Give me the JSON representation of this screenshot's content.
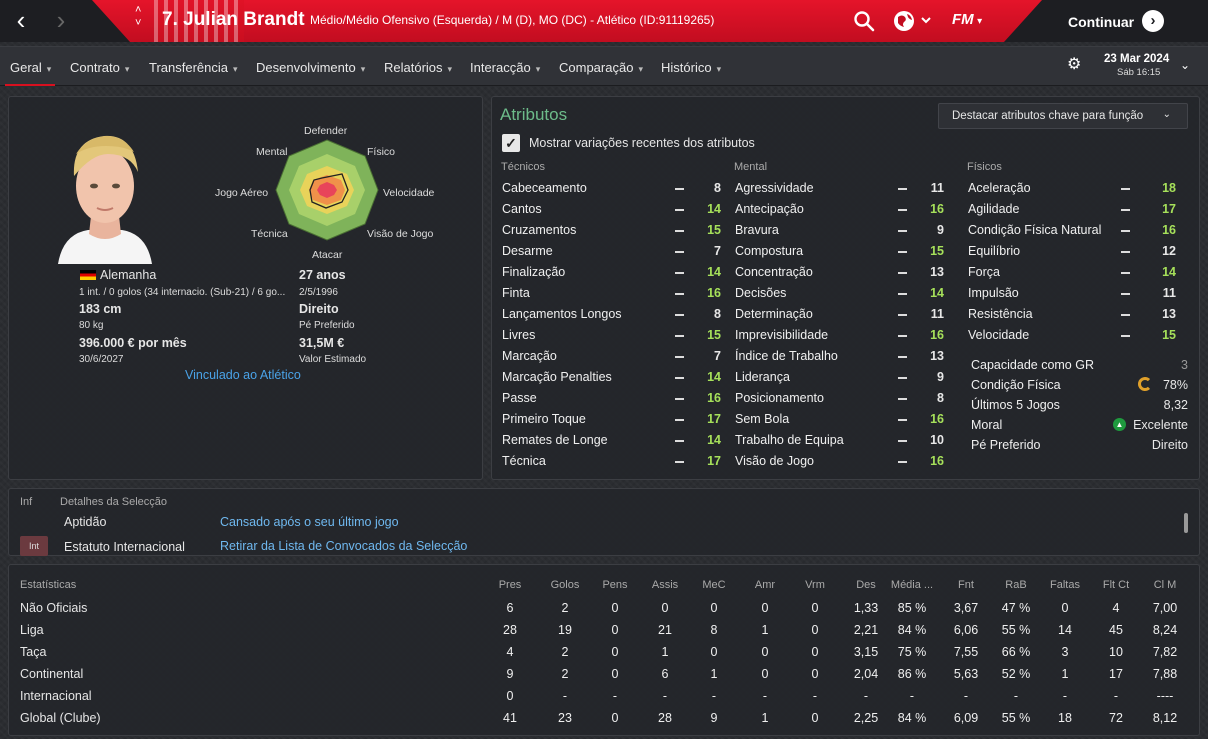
{
  "header": {
    "back_icon": "chevron-left-icon",
    "forward_icon": "chevron-right-icon",
    "title": "7. Julian Brandt",
    "subtitle": "Médio/Médio Ofensivo (Esquerda) / M (D), MO (DC) - Atlético (ID:91119265)",
    "continue_label": "Continuar",
    "logo_text": "FM",
    "accent_color": "#d8101f"
  },
  "tabs": [
    {
      "label": "Geral"
    },
    {
      "label": "Contrato"
    },
    {
      "label": "Transferência"
    },
    {
      "label": "Desenvolvimento"
    },
    {
      "label": "Relatórios"
    },
    {
      "label": "Interacção"
    },
    {
      "label": "Comparação"
    },
    {
      "label": "Histórico"
    }
  ],
  "clock": {
    "date": "23 Mar 2024",
    "time": "Sáb 16:15"
  },
  "profile": {
    "radar_labels": {
      "top": "Defender",
      "top_left": "Mental",
      "top_right": "Físico",
      "left": "Jogo Aéreo",
      "right": "Velocidade",
      "bottom_left": "Técnica",
      "bottom_right": "Visão de Jogo",
      "bottom": "Atacar"
    },
    "nationality": "Alemanha",
    "caps": "1 int. / 0 golos (34 internacio. (Sub-21) / 6 go...",
    "height": "183 cm",
    "weight": "80 kg",
    "wage": "396.000 € por mês",
    "contract_end": "30/6/2027",
    "age": "27 anos",
    "dob": "2/5/1996",
    "preferred_foot": "Direito",
    "preferred_foot_label": "Pé Preferido",
    "value": "31,5M €",
    "value_label": "Valor Estimado",
    "club_link": "Vinculado ao Atlético"
  },
  "attributes": {
    "title": "Atributos",
    "highlight_dropdown": "Destacar atributos chave para função",
    "show_changes_label": "Mostrar variações recentes dos atributos",
    "show_changes_checked": true,
    "technical_header": "Técnicos",
    "mental_header": "Mental",
    "physical_header": "Físicos",
    "technical": [
      {
        "name": "Cabeceamento",
        "value": "8"
      },
      {
        "name": "Cantos",
        "value": "14"
      },
      {
        "name": "Cruzamentos",
        "value": "15"
      },
      {
        "name": "Desarme",
        "value": "7"
      },
      {
        "name": "Finalização",
        "value": "14"
      },
      {
        "name": "Finta",
        "value": "16"
      },
      {
        "name": "Lançamentos Longos",
        "value": "8"
      },
      {
        "name": "Livres",
        "value": "15"
      },
      {
        "name": "Marcação",
        "value": "7"
      },
      {
        "name": "Marcação Penalties",
        "value": "14"
      },
      {
        "name": "Passe",
        "value": "16"
      },
      {
        "name": "Primeiro Toque",
        "value": "17"
      },
      {
        "name": "Remates de Longe",
        "value": "14"
      },
      {
        "name": "Técnica",
        "value": "17"
      }
    ],
    "mental": [
      {
        "name": "Agressividade",
        "value": "11"
      },
      {
        "name": "Antecipação",
        "value": "16"
      },
      {
        "name": "Bravura",
        "value": "9"
      },
      {
        "name": "Compostura",
        "value": "15"
      },
      {
        "name": "Concentração",
        "value": "13"
      },
      {
        "name": "Decisões",
        "value": "14"
      },
      {
        "name": "Determinação",
        "value": "11"
      },
      {
        "name": "Imprevisibilidade",
        "value": "16"
      },
      {
        "name": "Índice de Trabalho",
        "value": "13"
      },
      {
        "name": "Liderança",
        "value": "9"
      },
      {
        "name": "Posicionamento",
        "value": "8"
      },
      {
        "name": "Sem Bola",
        "value": "16"
      },
      {
        "name": "Trabalho de Equipa",
        "value": "10"
      },
      {
        "name": "Visão de Jogo",
        "value": "16"
      }
    ],
    "physical": [
      {
        "name": "Aceleração",
        "value": "18"
      },
      {
        "name": "Agilidade",
        "value": "17"
      },
      {
        "name": "Condição Física Natural",
        "value": "16"
      },
      {
        "name": "Equilíbrio",
        "value": "12"
      },
      {
        "name": "Força",
        "value": "14"
      },
      {
        "name": "Impulsão",
        "value": "11"
      },
      {
        "name": "Resistência",
        "value": "13"
      },
      {
        "name": "Velocidade",
        "value": "15"
      }
    ],
    "extra": [
      {
        "name": "Capacidade como GR",
        "value": "3"
      },
      {
        "name": "Condição Física",
        "value": "78%"
      },
      {
        "name": "Últimos 5 Jogos",
        "value": "8,32"
      },
      {
        "name": "Moral",
        "value": "Excelente"
      },
      {
        "name": "Pé Preferido",
        "value": "Direito"
      }
    ],
    "colors": {
      "high": "#a6e05a",
      "mid": "#e8e8e8",
      "low": "#e8e8e8",
      "fitness": "#e0a02a"
    }
  },
  "international": {
    "inf_label": "Inf",
    "title": "Detalhes da Selecção",
    "rows": [
      {
        "label": "Aptidão",
        "value": "Cansado após o seu último jogo",
        "badge": ""
      },
      {
        "label": "Estatuto Internacional",
        "value": "Retirar da Lista de Convocados da Selecção",
        "badge": "Int"
      }
    ]
  },
  "stats": {
    "title": "Estatísticas",
    "columns": [
      "Pres",
      "Golos",
      "Pens",
      "Assis",
      "MeC",
      "Amr",
      "Vrm",
      "Des",
      "Média ...",
      "Fnt",
      "RaB",
      "Faltas",
      "Flt Ct",
      "Cl M"
    ],
    "rows": [
      {
        "label": "Não Oficiais",
        "cells": [
          "6",
          "2",
          "0",
          "0",
          "0",
          "0",
          "0",
          "1,33",
          "85 %",
          "3,67",
          "47 %",
          "0",
          "4",
          "7,00"
        ]
      },
      {
        "label": "Liga",
        "cells": [
          "28",
          "19",
          "0",
          "21",
          "8",
          "1",
          "0",
          "2,21",
          "84 %",
          "6,06",
          "55 %",
          "14",
          "45",
          "8,24"
        ]
      },
      {
        "label": "Taça",
        "cells": [
          "4",
          "2",
          "0",
          "1",
          "0",
          "0",
          "0",
          "3,15",
          "75 %",
          "7,55",
          "66 %",
          "3",
          "10",
          "7,82"
        ]
      },
      {
        "label": "Continental",
        "cells": [
          "9",
          "2",
          "0",
          "6",
          "1",
          "0",
          "0",
          "2,04",
          "86 %",
          "5,63",
          "52 %",
          "1",
          "17",
          "7,88"
        ]
      },
      {
        "label": "Internacional",
        "cells": [
          "0",
          "-",
          "-",
          "-",
          "-",
          "-",
          "-",
          "-",
          "-",
          "-",
          "-",
          "-",
          "-",
          "----"
        ]
      },
      {
        "label": "Global (Clube)",
        "cells": [
          "41",
          "23",
          "0",
          "28",
          "9",
          "1",
          "0",
          "2,25",
          "84 %",
          "6,09",
          "55 %",
          "18",
          "72",
          "8,12"
        ]
      }
    ]
  }
}
